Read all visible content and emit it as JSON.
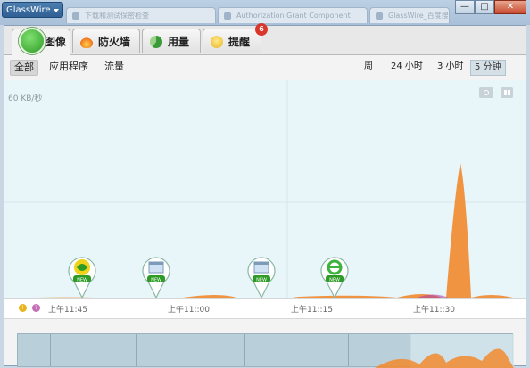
{
  "app": {
    "name": "GlassWire"
  },
  "browser_tabs": [
    {
      "label": "下载和测试保密检查"
    },
    {
      "label": "Authorization Grant Component"
    },
    {
      "label": "GlassWire_百度搜索"
    }
  ],
  "window_controls": {
    "minimize": "—",
    "maximize": "□",
    "close": "✕"
  },
  "tabs": [
    {
      "label": "图像",
      "active": true
    },
    {
      "label": "防火墙",
      "active": false
    },
    {
      "label": "用量",
      "active": false
    },
    {
      "label": "提醒",
      "active": false,
      "badge": "6"
    }
  ],
  "filters": [
    {
      "label": "全部",
      "active": true
    },
    {
      "label": "应用程序",
      "active": false
    },
    {
      "label": "流量",
      "active": false
    }
  ],
  "time_ranges": [
    {
      "label": "周",
      "active": false
    },
    {
      "label": "24 小时",
      "active": false
    },
    {
      "label": "3 小时",
      "active": false
    },
    {
      "label": "5 分钟",
      "active": true
    }
  ],
  "graph": {
    "rate_label": "60 KB/秒",
    "colors": {
      "background": "#e8f6f9",
      "spike": "#f28a2e"
    }
  },
  "app_pins": [
    {
      "icon": "qihoo-360-icon",
      "badge": "NEW"
    },
    {
      "icon": "window-app-icon",
      "badge": "NEW"
    },
    {
      "icon": "window-app-icon",
      "badge": "NEW"
    },
    {
      "icon": "ie-browser-icon",
      "badge": "NEW"
    }
  ],
  "timeline": {
    "labels": [
      "上午11:45",
      "上午11::00",
      "上午11::15",
      "上午11::30"
    ]
  }
}
